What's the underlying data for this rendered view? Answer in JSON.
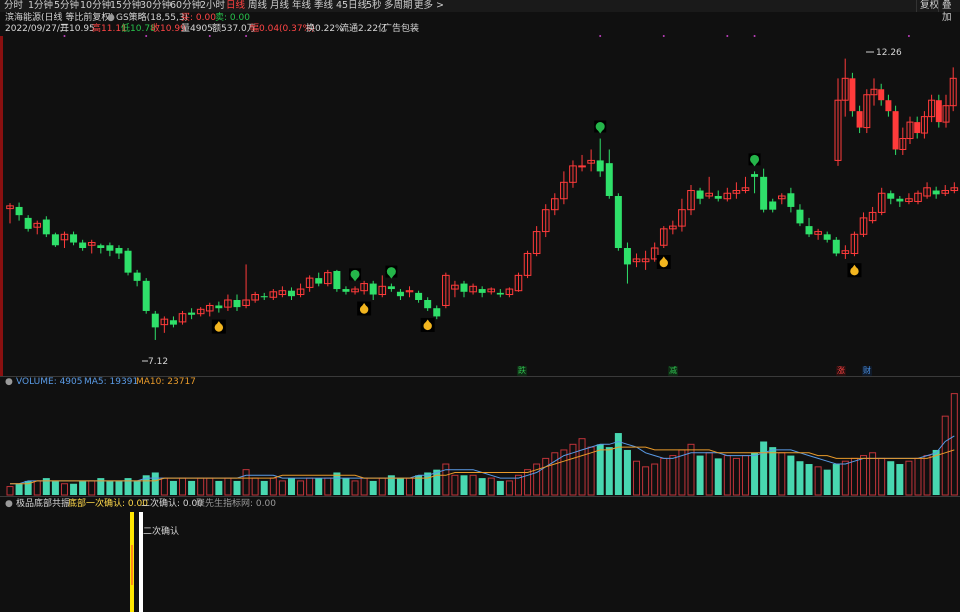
{
  "toolbar": {
    "timeframes": [
      "分时",
      "1分钟",
      "5分钟",
      "10分钟",
      "15分钟",
      "30分钟",
      "60分钟",
      "2小时",
      "日线",
      "周线",
      "月线",
      "年线",
      "季线",
      "45日线",
      "5秒",
      "多周期",
      "更多 >"
    ],
    "active_index": 8,
    "right_buttons": [
      "复权",
      "叠加"
    ]
  },
  "info": {
    "title": "滨海能源(日线 等比前复权)",
    "indicator": "GS策略(18,55,3)",
    "buy_label": "买: 0.00",
    "sell_label": "卖: 0.00",
    "date": "2022/09/27/二",
    "open": "开10.95",
    "high": "高11.11",
    "low": "低10.78",
    "close": "收10.99",
    "volume": "量4905",
    "amount": "额537.0万",
    "change": "幅0.04(0.37%)",
    "turnover": "换0.22%",
    "float_cap": "流通2.22亿",
    "sector": "广告包装"
  },
  "price_labels": {
    "high": "12.26",
    "low": "7.12"
  },
  "event_marks": [
    {
      "label": "跌",
      "color": "#2fbf4f"
    },
    {
      "label": "减",
      "color": "#2fbf4f"
    },
    {
      "label": "涨",
      "color": "#ff4545"
    },
    {
      "label": "财",
      "color": "#4a8fe0"
    }
  ],
  "volume_header": {
    "volume": "VOLUME: 4905",
    "ma5": "MA5: 19391",
    "ma10": "MA10: 23717"
  },
  "indicator_header": {
    "name": "极品底部共振",
    "first": "底部一次确认: 0.00",
    "second": "二次确认: 0.00",
    "extra": "聚先生指标网: 0.00"
  },
  "signal_label": "二次确认",
  "colors": {
    "up": "#ff3b3b",
    "down": "#2fe06a",
    "ma5": "#5a9be6",
    "ma10": "#e89a2a",
    "bg": "#101010",
    "yellow": "#ffe600"
  },
  "chart_data": {
    "type": "candlestick",
    "x_range": [
      1,
      105
    ],
    "y_range": [
      6.9,
      12.6
    ],
    "candles": [
      [
        1,
        9.52,
        9.57,
        9.25,
        9.62
      ],
      [
        2,
        9.55,
        9.4,
        9.3,
        9.63
      ],
      [
        3,
        9.35,
        9.15,
        9.1,
        9.4
      ],
      [
        4,
        9.18,
        9.25,
        9.05,
        9.3
      ],
      [
        5,
        9.32,
        9.05,
        9.0,
        9.38
      ],
      [
        6,
        9.05,
        8.85,
        8.82,
        9.08
      ],
      [
        7,
        8.95,
        9.05,
        8.8,
        9.1
      ],
      [
        8,
        9.05,
        8.9,
        8.85,
        9.1
      ],
      [
        9,
        8.9,
        8.8,
        8.75,
        8.95
      ],
      [
        10,
        8.85,
        8.9,
        8.7,
        8.95
      ],
      [
        11,
        8.85,
        8.8,
        8.7,
        8.88
      ],
      [
        12,
        8.85,
        8.75,
        8.65,
        8.9
      ],
      [
        13,
        8.8,
        8.7,
        8.6,
        8.85
      ],
      [
        14,
        8.75,
        8.35,
        8.3,
        8.8
      ],
      [
        15,
        8.35,
        8.2,
        8.1,
        8.4
      ],
      [
        16,
        8.2,
        7.65,
        7.6,
        8.25
      ],
      [
        17,
        7.6,
        7.35,
        7.12,
        7.65
      ],
      [
        18,
        7.4,
        7.5,
        7.25,
        7.55
      ],
      [
        19,
        7.48,
        7.4,
        7.35,
        7.55
      ],
      [
        20,
        7.45,
        7.6,
        7.4,
        7.65
      ],
      [
        21,
        7.62,
        7.58,
        7.5,
        7.7
      ],
      [
        22,
        7.6,
        7.68,
        7.55,
        7.72
      ],
      [
        23,
        7.65,
        7.75,
        7.55,
        7.8
      ],
      [
        24,
        7.75,
        7.7,
        7.62,
        7.82
      ],
      [
        25,
        7.72,
        7.85,
        7.65,
        7.95
      ],
      [
        26,
        7.85,
        7.72,
        7.65,
        7.95
      ],
      [
        27,
        7.75,
        7.85,
        7.7,
        8.5
      ],
      [
        28,
        7.85,
        7.95,
        7.8,
        8.0
      ],
      [
        29,
        7.92,
        7.9,
        7.85,
        7.98
      ],
      [
        30,
        7.9,
        8.0,
        7.85,
        8.05
      ],
      [
        31,
        7.95,
        8.02,
        7.9,
        8.1
      ],
      [
        32,
        8.02,
        7.92,
        7.85,
        8.08
      ],
      [
        33,
        7.95,
        8.05,
        7.9,
        8.15
      ],
      [
        34,
        8.08,
        8.25,
        8.0,
        8.3
      ],
      [
        35,
        8.25,
        8.15,
        8.1,
        8.35
      ],
      [
        36,
        8.15,
        8.35,
        8.1,
        8.4
      ],
      [
        37,
        8.38,
        8.05,
        8.0,
        8.4
      ],
      [
        38,
        8.05,
        8.0,
        7.95,
        8.1
      ],
      [
        39,
        8.0,
        8.05,
        7.95,
        8.1
      ],
      [
        40,
        8.02,
        8.15,
        7.95,
        8.2
      ],
      [
        41,
        8.15,
        7.95,
        7.85,
        8.2
      ],
      [
        42,
        7.95,
        8.1,
        7.9,
        8.3
      ],
      [
        43,
        8.1,
        8.05,
        8.0,
        8.15
      ],
      [
        44,
        8.0,
        7.92,
        7.85,
        8.05
      ],
      [
        45,
        8.0,
        8.02,
        7.9,
        8.1
      ],
      [
        46,
        7.98,
        7.85,
        7.8,
        8.02
      ],
      [
        47,
        7.85,
        7.7,
        7.65,
        7.9
      ],
      [
        48,
        7.7,
        7.55,
        7.5,
        7.75
      ],
      [
        49,
        7.75,
        8.3,
        7.7,
        8.35
      ],
      [
        50,
        8.05,
        8.12,
        7.9,
        8.2
      ],
      [
        51,
        8.15,
        8.0,
        7.9,
        8.2
      ],
      [
        52,
        8.0,
        8.1,
        7.95,
        8.15
      ],
      [
        53,
        8.05,
        7.98,
        7.9,
        8.1
      ],
      [
        54,
        8.0,
        8.05,
        7.95,
        8.08
      ],
      [
        55,
        7.98,
        7.95,
        7.9,
        8.05
      ],
      [
        56,
        7.95,
        8.05,
        7.9,
        8.08
      ],
      [
        57,
        8.02,
        8.3,
        8.0,
        8.35
      ],
      [
        58,
        8.3,
        8.7,
        8.25,
        8.75
      ],
      [
        59,
        8.7,
        9.1,
        8.65,
        9.2
      ],
      [
        60,
        9.1,
        9.5,
        9.0,
        9.6
      ],
      [
        61,
        9.5,
        9.7,
        9.4,
        9.8
      ],
      [
        62,
        9.7,
        10.0,
        9.6,
        10.2
      ],
      [
        63,
        10.0,
        10.3,
        9.9,
        10.4
      ],
      [
        64,
        10.3,
        10.3,
        10.2,
        10.5
      ],
      [
        65,
        10.35,
        10.4,
        10.2,
        10.6
      ],
      [
        66,
        10.4,
        10.2,
        10.1,
        10.8
      ],
      [
        67,
        10.35,
        9.75,
        9.7,
        10.6
      ],
      [
        68,
        9.75,
        8.8,
        8.75,
        9.8
      ],
      [
        69,
        8.8,
        8.5,
        8.15,
        8.9
      ],
      [
        70,
        8.55,
        8.6,
        8.45,
        8.7
      ],
      [
        71,
        8.55,
        8.6,
        8.4,
        8.75
      ],
      [
        72,
        8.6,
        8.8,
        8.55,
        8.9
      ],
      [
        73,
        8.85,
        9.15,
        8.8,
        9.2
      ],
      [
        74,
        9.15,
        9.2,
        9.05,
        9.3
      ],
      [
        75,
        9.2,
        9.5,
        9.1,
        9.7
      ],
      [
        76,
        9.5,
        9.85,
        9.4,
        9.95
      ],
      [
        77,
        9.85,
        9.7,
        9.6,
        9.9
      ],
      [
        78,
        9.75,
        9.8,
        9.7,
        10.1
      ],
      [
        79,
        9.75,
        9.7,
        9.65,
        9.85
      ],
      [
        80,
        9.7,
        9.8,
        9.65,
        9.9
      ],
      [
        81,
        9.8,
        9.85,
        9.7,
        10.0
      ],
      [
        82,
        9.85,
        9.9,
        9.8,
        10.1
      ],
      [
        83,
        10.15,
        10.1,
        9.8,
        10.2
      ],
      [
        84,
        10.1,
        9.5,
        9.45,
        10.25
      ],
      [
        85,
        9.65,
        9.5,
        9.45,
        9.7
      ],
      [
        86,
        9.7,
        9.75,
        9.6,
        9.8
      ],
      [
        87,
        9.8,
        9.55,
        9.45,
        9.9
      ],
      [
        88,
        9.5,
        9.25,
        9.2,
        9.6
      ],
      [
        89,
        9.2,
        9.05,
        9.0,
        9.35
      ],
      [
        90,
        9.05,
        9.1,
        8.95,
        9.15
      ],
      [
        91,
        9.05,
        8.95,
        8.9,
        9.1
      ],
      [
        92,
        8.95,
        8.7,
        8.65,
        9.0
      ],
      [
        93,
        8.7,
        8.75,
        8.6,
        8.85
      ],
      [
        94,
        8.7,
        9.05,
        8.65,
        9.1
      ],
      [
        95,
        9.05,
        9.35,
        9.0,
        9.45
      ],
      [
        96,
        9.3,
        9.45,
        9.25,
        9.55
      ],
      [
        97,
        9.45,
        9.8,
        9.4,
        9.9
      ],
      [
        98,
        9.8,
        9.7,
        9.6,
        9.85
      ],
      [
        99,
        9.7,
        9.65,
        9.55,
        9.75
      ],
      [
        100,
        9.65,
        9.7,
        9.6,
        9.8
      ],
      [
        101,
        9.65,
        9.8,
        9.6,
        9.85
      ],
      [
        102,
        9.75,
        9.9,
        9.7,
        10.0
      ],
      [
        103,
        9.85,
        9.78,
        9.7,
        9.92
      ],
      [
        104,
        9.8,
        9.85,
        9.75,
        9.95
      ],
      [
        105,
        9.85,
        9.9,
        9.8,
        10.0
      ]
    ],
    "extra_candles_note": "",
    "volume": [
      3,
      4,
      5,
      5,
      6,
      5,
      4,
      4,
      5,
      5,
      6,
      5,
      5,
      6,
      5,
      7,
      8,
      6,
      5,
      6,
      5,
      6,
      6,
      5,
      6,
      5,
      9,
      6,
      5,
      6,
      5,
      6,
      5,
      6,
      6,
      6,
      8,
      6,
      5,
      6,
      5,
      6,
      7,
      6,
      6,
      7,
      8,
      9,
      11,
      7,
      7,
      7,
      6,
      6,
      5,
      5,
      7,
      9,
      11,
      13,
      15,
      16,
      18,
      20,
      17,
      18,
      17,
      22,
      16,
      12,
      10,
      11,
      13,
      14,
      16,
      18,
      14,
      15,
      13,
      14,
      13,
      14,
      15,
      19,
      17,
      15,
      14,
      12,
      11,
      10,
      9,
      11,
      12,
      13,
      14,
      15,
      13,
      12,
      11,
      12,
      13,
      14,
      16,
      28,
      36
    ],
    "ma5": [
      4,
      4,
      5,
      5,
      5,
      5,
      5,
      5,
      5,
      5,
      5,
      5,
      5,
      5,
      5,
      6,
      6,
      6,
      6,
      6,
      6,
      6,
      6,
      6,
      6,
      6,
      7,
      7,
      7,
      7,
      6,
      6,
      6,
      6,
      6,
      6,
      6,
      6,
      6,
      6,
      6,
      6,
      6,
      6,
      6,
      7,
      7,
      8,
      9,
      9,
      9,
      9,
      8,
      7,
      6,
      6,
      6,
      7,
      8,
      10,
      12,
      14,
      15,
      16,
      17,
      18,
      18,
      19,
      18,
      17,
      15,
      14,
      13,
      13,
      14,
      15,
      15,
      15,
      15,
      14,
      14,
      14,
      14,
      15,
      16,
      16,
      16,
      15,
      14,
      13,
      12,
      11,
      11,
      12,
      13,
      13,
      13,
      13,
      13,
      13,
      13,
      14,
      15,
      19,
      21
    ],
    "ma10": [
      4,
      4,
      4,
      5,
      5,
      5,
      5,
      5,
      5,
      5,
      5,
      5,
      5,
      5,
      5,
      5,
      5,
      6,
      6,
      6,
      6,
      6,
      6,
      6,
      6,
      6,
      6,
      6,
      6,
      6,
      7,
      7,
      7,
      7,
      7,
      7,
      7,
      7,
      7,
      6,
      6,
      6,
      6,
      6,
      6,
      6,
      6,
      7,
      7,
      8,
      8,
      8,
      8,
      8,
      8,
      8,
      8,
      8,
      9,
      10,
      11,
      12,
      13,
      14,
      15,
      16,
      16,
      17,
      17,
      17,
      17,
      16,
      16,
      16,
      16,
      16,
      16,
      16,
      15,
      15,
      15,
      15,
      15,
      15,
      15,
      15,
      15,
      15,
      15,
      14,
      14,
      13,
      13,
      13,
      13,
      13,
      13,
      13,
      13,
      13,
      13,
      13,
      14,
      15,
      16
    ],
    "signals": [
      {
        "x": 24,
        "type": "gold"
      },
      {
        "x": 40,
        "type": "gold"
      },
      {
        "x": 47,
        "type": "gold"
      },
      {
        "x": 73,
        "type": "gold"
      },
      {
        "x": 94,
        "type": "gold"
      },
      {
        "x": 39,
        "type": "green"
      },
      {
        "x": 43,
        "type": "green"
      },
      {
        "x": 66,
        "type": "green"
      },
      {
        "x": 83,
        "type": "green"
      }
    ]
  }
}
